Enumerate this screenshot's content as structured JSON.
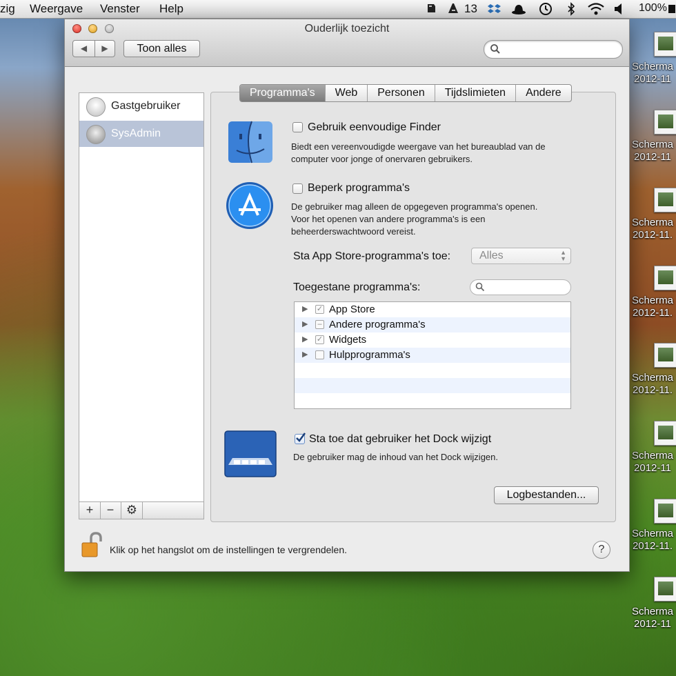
{
  "menubar": {
    "items": [
      "zig",
      "Weergave",
      "Venster",
      "Help"
    ],
    "status": {
      "evernote": "evernote-icon",
      "adobe_count": "13",
      "battery": "100%"
    }
  },
  "desktop": {
    "icon_labels": [
      {
        "name": "Scherma",
        "date": "2012-11"
      },
      {
        "name": "Scherma",
        "date": "2012-11"
      },
      {
        "name": "Scherma",
        "date": "2012-11."
      },
      {
        "name": "Scherma",
        "date": "2012-11."
      },
      {
        "name": "Scherma",
        "date": "2012-11."
      },
      {
        "name": "Scherma",
        "date": "2012-11"
      },
      {
        "name": "Scherma",
        "date": "2012-11."
      },
      {
        "name": "Scherma",
        "date": "2012-11"
      }
    ]
  },
  "window": {
    "title": "Ouderlijk toezicht",
    "show_all": "Toon alles",
    "search_placeholder": ""
  },
  "users": [
    {
      "name": "Gastgebruiker",
      "selected": false
    },
    {
      "name": "SysAdmin",
      "selected": true
    }
  ],
  "user_buttons": {
    "add": "+",
    "remove": "−",
    "settings": "⚙"
  },
  "tabs": [
    "Programma's",
    "Web",
    "Personen",
    "Tijdslimieten",
    "Andere"
  ],
  "active_tab": "Programma's",
  "finder": {
    "label": "Gebruik eenvoudige Finder",
    "checked": false,
    "desc": [
      "Biedt een vereenvoudigde weergave van het bureaublad van de",
      "computer voor jonge of onervaren gebruikers."
    ]
  },
  "limit": {
    "label": "Beperk programma's",
    "checked": false,
    "desc": [
      "De gebruiker mag alleen de opgegeven programma's openen.",
      "Voor het openen van andere programma's is een",
      "beheerderswachtwoord vereist."
    ]
  },
  "appstore": {
    "label": "Sta App Store-programma's toe:",
    "value": "Alles"
  },
  "allowed": {
    "label": "Toegestane programma's:",
    "items": [
      {
        "name": "App Store",
        "state": "✓"
      },
      {
        "name": "Andere programma's",
        "state": "–"
      },
      {
        "name": "Widgets",
        "state": "✓"
      },
      {
        "name": "Hulpprogramma's",
        "state": ""
      }
    ]
  },
  "dock": {
    "label": "Sta toe dat gebruiker het Dock wijzigt",
    "checked": true,
    "desc": "De gebruiker mag de inhoud van het Dock wijzigen."
  },
  "logs_button": "Logbestanden...",
  "lock_text": "Klik op het hangslot om de instellingen te vergrendelen.",
  "help": "?",
  "colors": {
    "accent": "#2f77d0",
    "selected_row": "#b9c4d8"
  }
}
